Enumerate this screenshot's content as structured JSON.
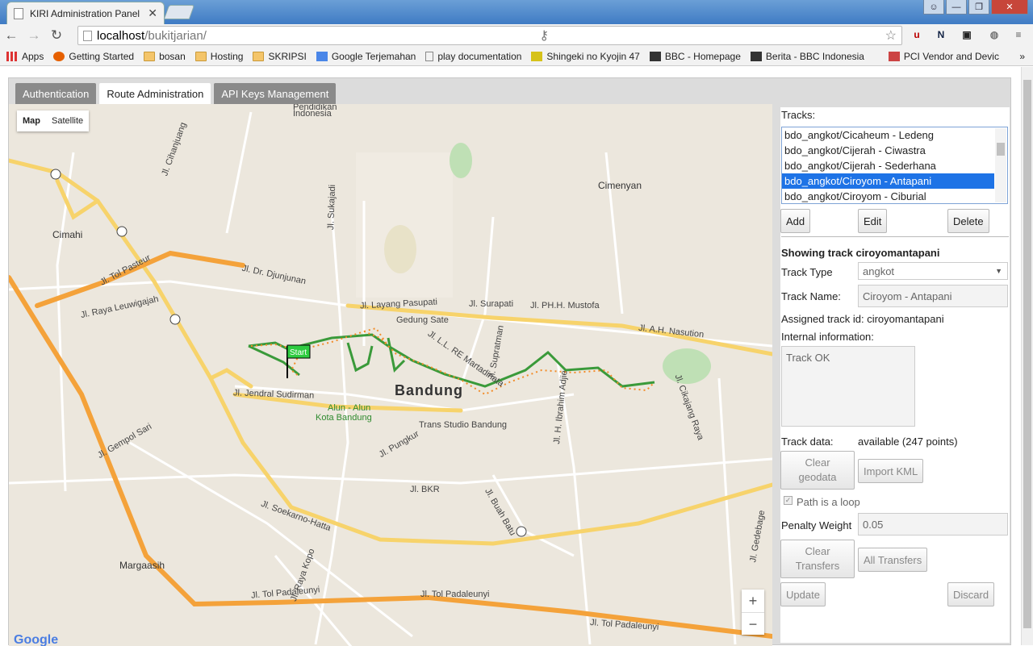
{
  "browser": {
    "tab_title": "KIRI Administration Panel",
    "url_host": "localhost",
    "url_path": "/bukitjarian/",
    "bookmarks": [
      "Apps",
      "Getting Started",
      "bosan",
      "Hosting",
      "SKRIPSI",
      "Google Terjemahan",
      "play documentation",
      "Shingeki no Kyojin 47",
      "BBC - Homepage",
      "Berita - BBC Indonesia",
      "PCI Vendor and Devic"
    ]
  },
  "tabs": [
    "Authentication",
    "Route Administration",
    "API Keys Management"
  ],
  "map": {
    "type_map": "Map",
    "type_satellite": "Satellite",
    "zoom_in": "+",
    "zoom_out": "−",
    "start_marker": "Start",
    "logo": "Google",
    "labels": {
      "bandung": "Bandung",
      "cimahi": "Cimahi",
      "cimenyan": "Cimenyan",
      "margaasih": "Margaasih",
      "gedung_sate": "Gedung Sate",
      "alun1": "Alun - Alun",
      "alun2": "Kota Bandung",
      "trans_studio": "Trans Studio Bandung",
      "pendidikan": "Pendidikan",
      "indonesia": "Indonesia",
      "tol_pasteur": "Jl. Tol Pasteur",
      "djunjunan": "Jl. Dr. Djunjunan",
      "leuwigajah": "Jl. Raya Leuwigajah",
      "sudirman": "Jl. Jendral Sudirman",
      "layang": "Jl. Layang Pasupati",
      "surapati": "Jl. Surapati",
      "ah_nasution": "Jl. A.H. Nasution",
      "ph_mustofa": "Jl. PH.H. Mustofa",
      "soekarno": "Jl. Soekarno-Hatta",
      "tol_padaleunyi": "Jl. Tol Padaleunyi",
      "bkr": "Jl. BKR",
      "gempol": "Jl. Gempol Sari",
      "pungkur": "Jl. Pungkur",
      "cikajang": "Jl. Cikajang Raya",
      "buah_batu": "Jl. Buah Batu",
      "kopo": "Jl. Raya Kopo",
      "gedebage": "Jl. Gedebage",
      "sukajadi": "Jl. Sukajadi",
      "martadinata": "Jl. L.L. RE Martadinata",
      "supratman": "Jl. Supratman",
      "ibrahim": "Jl. H. Ibrahim Adjie",
      "cihanjuang": "Jl. Cihanjuang"
    }
  },
  "side": {
    "tracks_label": "Tracks:",
    "tracks": [
      "bdo_angkot/Cicaheum - Ledeng",
      "bdo_angkot/Cijerah - Ciwastra",
      "bdo_angkot/Cijerah - Sederhana",
      "bdo_angkot/Ciroyom - Antapani",
      "bdo_angkot/Ciroyom - Ciburial"
    ],
    "add": "Add",
    "edit": "Edit",
    "delete": "Delete",
    "showing": "Showing track ciroyomantapani",
    "track_type_label": "Track Type",
    "track_type_value": "angkot",
    "track_name_label": "Track Name:",
    "track_name_value": "Ciroyom - Antapani",
    "assigned_id": "Assigned track id: ciroyomantapani",
    "internal_label": "Internal information:",
    "internal_value": "Track OK",
    "track_data_label": "Track data:",
    "track_data_value": "available (247 points)",
    "clear_geodata": "Clear geodata",
    "import_kml": "Import KML",
    "loop_label": "Path is a loop",
    "penalty_label": "Penalty Weight",
    "penalty_value": "0.05",
    "clear_transfers": "Clear Transfers",
    "all_transfers": "All Transfers",
    "update": "Update",
    "discard": "Discard"
  }
}
